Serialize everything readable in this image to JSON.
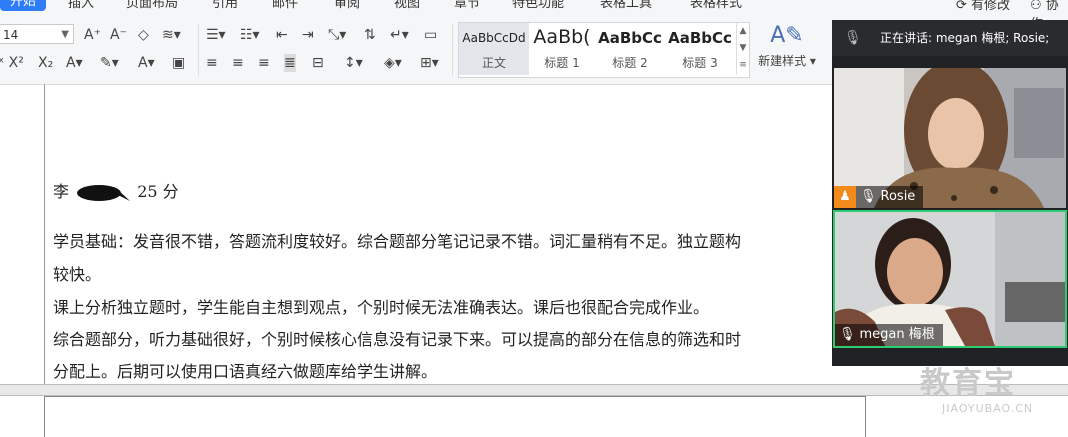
{
  "menubar": {
    "items": [
      "开始",
      "插入",
      "页面布局",
      "引用",
      "邮件",
      "审阅",
      "视图",
      "章节",
      "特色功能",
      "表格工具",
      "表格样式"
    ],
    "active_index": 0,
    "right_items": [
      "有修改",
      "协作"
    ]
  },
  "toolbar": {
    "font_size": "14",
    "styles": [
      {
        "preview": "AaBbCcDd",
        "label": "正文"
      },
      {
        "preview": "AaBb(",
        "label": "标题 1"
      },
      {
        "preview": "AaBbCc",
        "label": "标题 2"
      },
      {
        "preview": "AaBbCc",
        "label": "标题 3"
      }
    ],
    "new_style": "新建样式"
  },
  "document": {
    "line1_prefix": "李",
    "line1_score": "25 分",
    "lines": [
      "学员基础：发音很不错，答题流利度较好。综合题部分笔记记录不错。词汇量稍有不足。独立题构",
      "较快。",
      "课上分析独立题时，学生能自主想到观点，个别时候无法准确表达。课后也很配合完成作业。",
      "综合题部分，听力基础很好，个别时候核心信息没有记录下来。可以提高的部分在信息的筛选和时",
      "分配上。后期可以使用口语真经六做题库给学生讲解。"
    ]
  },
  "video": {
    "speaking_label": "正在讲话: megan 梅根; Rosie;",
    "participants": [
      {
        "name": "Rosie"
      },
      {
        "name": "megan 梅根"
      }
    ]
  },
  "watermark": {
    "title": "教育宝",
    "url": "JIAOYUBAO.CN"
  },
  "colors": {
    "accent": "#2f7df6",
    "active_speaker": "#2ecc71",
    "host_badge": "#f28b1c"
  }
}
